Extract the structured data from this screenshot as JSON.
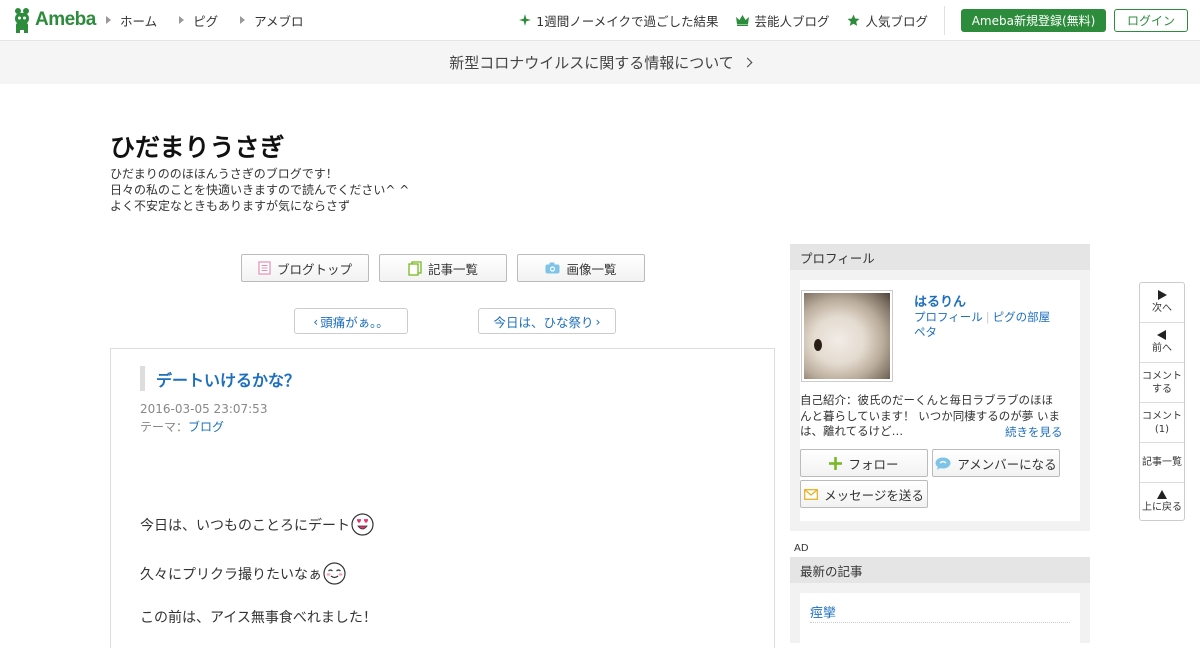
{
  "header": {
    "logo_text": "Ameba",
    "nav_left": [
      {
        "label": "ホーム"
      },
      {
        "label": "ピグ"
      },
      {
        "label": "アメブロ"
      }
    ],
    "nav_right": [
      {
        "label": "1週間ノーメイクで過ごした結果",
        "icon": "sparkle-icon"
      },
      {
        "label": "芸能人ブログ",
        "icon": "crown-icon"
      },
      {
        "label": "人気ブログ",
        "icon": "star-icon"
      }
    ],
    "register_label": "Ameba新規登録(無料)",
    "login_label": "ログイン"
  },
  "notice": {
    "text": "新型コロナウイルスに関する情報について"
  },
  "blog": {
    "title": "ひだまりうさぎ",
    "description_lines": [
      "ひだまりののほほんうさぎのブログです！",
      "日々の私のことを快適いきますので読んでください^ ^",
      "よく不安定なときもありますが気にならさず"
    ]
  },
  "tabs": [
    {
      "label": "ブログトップ",
      "icon": "document-icon"
    },
    {
      "label": "記事一覧",
      "icon": "pages-icon"
    },
    {
      "label": "画像一覧",
      "icon": "camera-icon"
    }
  ],
  "pager": {
    "prev_label": "頭痛がぁ。。",
    "next_label": "今日は、ひな祭り"
  },
  "article": {
    "title": "デートいけるかな？",
    "date": "2016-03-05 23:07:53",
    "theme_prefix": "テーマ：",
    "theme": "ブログ",
    "lines": [
      "今日は、いつものことろにデート",
      "久々にプリクラ撮りたいなぁ",
      "この前は、アイス無事食べれました！"
    ]
  },
  "sidebar": {
    "profile_heading": "プロフィール",
    "name": "はるりん",
    "link_profile": "プロフィール",
    "link_pig": "ピグの部屋",
    "link_peta": "ペタ",
    "intro": "自己紹介：彼氏のだーくんと毎日ラブラブのほほんと暮らしています！ いつか同棲するのが夢 いまは、離れてるけど…",
    "more_label": "続きを見る",
    "follow_label": "フォロー",
    "amember_label": "アメンバーになる",
    "message_label": "メッセージを送る",
    "ad_label": "AD",
    "recent_heading": "最新の記事",
    "recent_items": [
      "痙攣"
    ]
  },
  "float_nav": [
    {
      "label": "次へ",
      "icon": "play-right-icon"
    },
    {
      "label": "前へ",
      "icon": "play-left-icon"
    },
    {
      "label": "コメントする",
      "line1": "コメント",
      "line2": "する"
    },
    {
      "label": "コメント(1)",
      "line1": "コメント",
      "line2": "(1)"
    },
    {
      "label": "記事一覧",
      "line1": "記事一覧"
    },
    {
      "label": "上に戻る",
      "icon": "arrow-up-icon"
    }
  ],
  "colors": {
    "brand_green": "#2d8c3c",
    "link_blue": "#1d6fbf",
    "sidebar_gray": "#e5e5e5"
  }
}
